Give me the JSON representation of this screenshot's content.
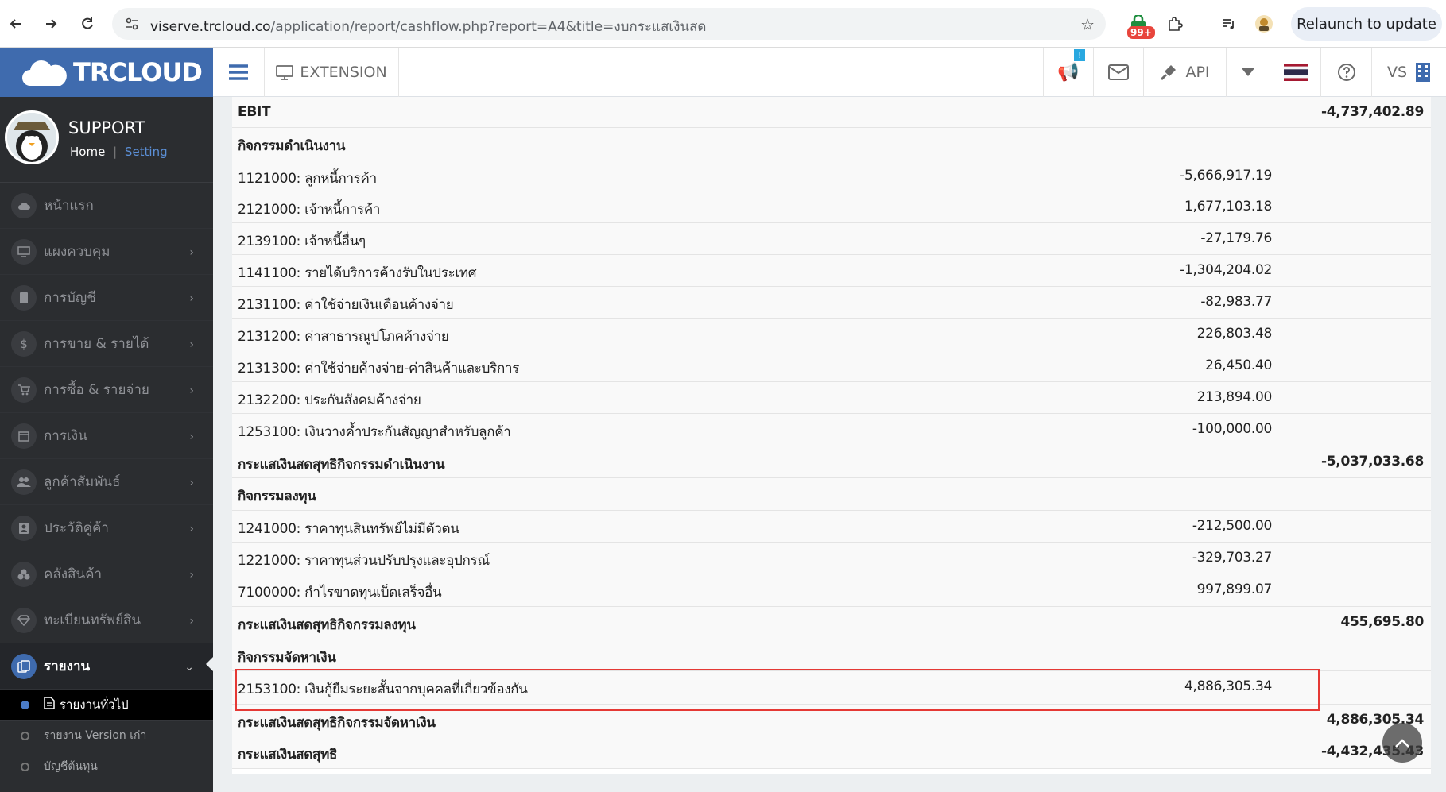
{
  "browser": {
    "url_host": "viserve.trcloud.co",
    "url_path": "/application/report/cashflow.php?report=A4&title=งบกระแสเงินสด",
    "badge": "99+",
    "relaunch_label": "Relaunch to update"
  },
  "header": {
    "logo_text": "TRCLOUD",
    "extension_label": "EXTENSION",
    "api_label": "API",
    "notif_count": "!",
    "user_short": "VS"
  },
  "profile": {
    "name": "SUPPORT",
    "home_link": "Home",
    "separator": "|",
    "setting_link": "Setting"
  },
  "sidebar": {
    "items": [
      {
        "label": "หน้าแรก",
        "icon": "cloud-icon"
      },
      {
        "label": "แผงควบคุม",
        "icon": "monitor-icon"
      },
      {
        "label": "การบัญชี",
        "icon": "book-icon"
      },
      {
        "label": "การขาย & รายได้",
        "icon": "dollar-icon"
      },
      {
        "label": "การซื้อ & รายจ่าย",
        "icon": "cart-icon"
      },
      {
        "label": "การเงิน",
        "icon": "calendar-icon"
      },
      {
        "label": "ลูกค้าสัมพันธ์",
        "icon": "users-icon"
      },
      {
        "label": "ประวัติคู่ค้า",
        "icon": "contact-icon"
      },
      {
        "label": "คลังสินค้า",
        "icon": "boxes-icon"
      },
      {
        "label": "ทะเบียนทรัพย์สิน",
        "icon": "diamond-icon"
      },
      {
        "label": "รายงาน",
        "icon": "report-icon"
      }
    ],
    "sub_items": [
      {
        "label": "รายงานทั่วไป"
      },
      {
        "label": "รายงาน Version เก่า"
      },
      {
        "label": "บัญชีต้นทุน"
      }
    ]
  },
  "report": {
    "rows": [
      {
        "label": "EBIT",
        "amount": "",
        "total": "-4,737,402.89",
        "bold": true
      },
      {
        "label": "กิจกรรมดำเนินงาน",
        "amount": "",
        "total": "",
        "bold": true
      },
      {
        "label": "1121000: ลูกหนี้การค้า",
        "amount": "-5,666,917.19",
        "total": ""
      },
      {
        "label": "2121000: เจ้าหนี้การค้า",
        "amount": "1,677,103.18",
        "total": ""
      },
      {
        "label": "2139100: เจ้าหนี้อื่นๆ",
        "amount": "-27,179.76",
        "total": ""
      },
      {
        "label": "1141100: รายได้บริการค้างรับในประเทศ",
        "amount": "-1,304,204.02",
        "total": ""
      },
      {
        "label": "2131100: ค่าใช้จ่ายเงินเดือนค้างจ่าย",
        "amount": "-82,983.77",
        "total": ""
      },
      {
        "label": "2131200: ค่าสาธารณูปโภคค้างจ่าย",
        "amount": "226,803.48",
        "total": ""
      },
      {
        "label": "2131300: ค่าใช้จ่ายค้างจ่าย-ค่าสินค้าและบริการ",
        "amount": "26,450.40",
        "total": ""
      },
      {
        "label": "2132200: ประกันสังคมค้างจ่าย",
        "amount": "213,894.00",
        "total": ""
      },
      {
        "label": "1253100: เงินวางค้ำประกันสัญญาสำหรับลูกค้า",
        "amount": "-100,000.00",
        "total": ""
      },
      {
        "label": "กระแสเงินสดสุทธิกิจกรรมดำเนินงาน",
        "amount": "",
        "total": "-5,037,033.68",
        "bold": true
      },
      {
        "label": "กิจกรรมลงทุน",
        "amount": "",
        "total": "",
        "bold": true
      },
      {
        "label": "1241000: ราคาทุนสินทรัพย์ไม่มีตัวตน",
        "amount": "-212,500.00",
        "total": ""
      },
      {
        "label": "1221000: ราคาทุนส่วนปรับปรุงและอุปกรณ์",
        "amount": "-329,703.27",
        "total": ""
      },
      {
        "label": "7100000: กำไรขาดทุนเบ็ดเสร็จอื่น",
        "amount": "997,899.07",
        "total": ""
      },
      {
        "label": "กระแสเงินสดสุทธิกิจกรรมลงทุน",
        "amount": "",
        "total": "455,695.80",
        "bold": true
      },
      {
        "label": "กิจกรรมจัดหาเงิน",
        "amount": "",
        "total": "",
        "bold": true
      },
      {
        "label": "2153100: เงินกู้ยืมระยะสั้นจากบุคคลที่เกี่ยวข้องกัน",
        "amount": "4,886,305.34",
        "total": ""
      },
      {
        "label": "กระแสเงินสดสุทธิกิจกรรมจัดหาเงิน",
        "amount": "",
        "total": "4,886,305.34",
        "bold": true
      },
      {
        "label": "กระแสเงินสดสุทธิ",
        "amount": "",
        "total": "-4,432,435.43",
        "bold": true
      }
    ]
  },
  "colors": {
    "brand": "#3f6bae",
    "sidebar": "#2b2d30",
    "highlight": "#e53935"
  }
}
